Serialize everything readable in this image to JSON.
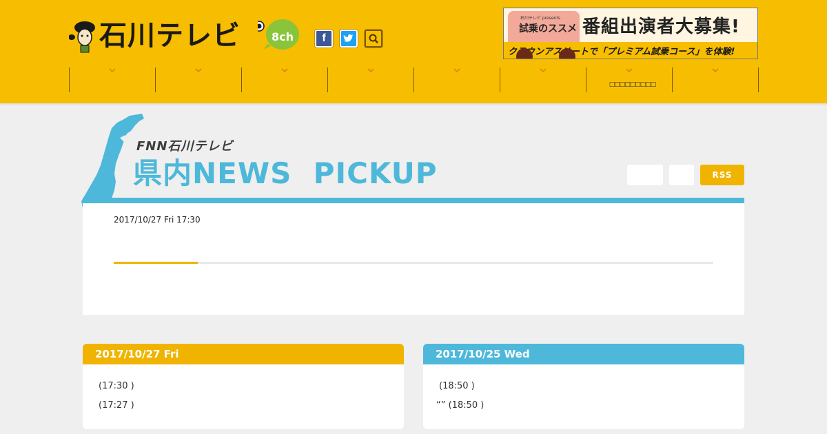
{
  "header": {
    "logo_text": "石川テレビ",
    "channel": "8ch",
    "social": [
      {
        "name": "facebook",
        "icon": "facebook-icon"
      },
      {
        "name": "twitter",
        "icon": "twitter-icon"
      },
      {
        "name": "search",
        "icon": "search-icon"
      }
    ],
    "banner": {
      "presents": "石川テレビ presents",
      "title": "試乗のススメ",
      "headline": "番組出演者大募集!",
      "subline": "クラウンアスリートで「プレミアム試乗コース」を体験!"
    },
    "nav": [
      {
        "label": ""
      },
      {
        "label": ""
      },
      {
        "label": ""
      },
      {
        "label": ""
      },
      {
        "label": ""
      },
      {
        "label": ""
      },
      {
        "label": "□□□□□□□□□"
      },
      {
        "label": ""
      }
    ]
  },
  "title_area": {
    "brand": "FNN石川テレビ",
    "title": "県内NEWS  PICKUP",
    "rss_label": "RSS"
  },
  "main": {
    "date": "2017/10/27 Fri 17:30",
    "progress": 0.14
  },
  "day_cards": [
    {
      "date": "2017/10/27 Fri",
      "items": [
        "(17:30 )",
        "(17:27 )"
      ]
    },
    {
      "date": "2017/10/25 Wed",
      "items": [
        "(18:50 )",
        "“” (18:50 )"
      ]
    }
  ],
  "colors": {
    "brand_yellow": "#f7bd00",
    "accent_blue": "#4db8d9",
    "accent_orange": "#f0b400"
  }
}
